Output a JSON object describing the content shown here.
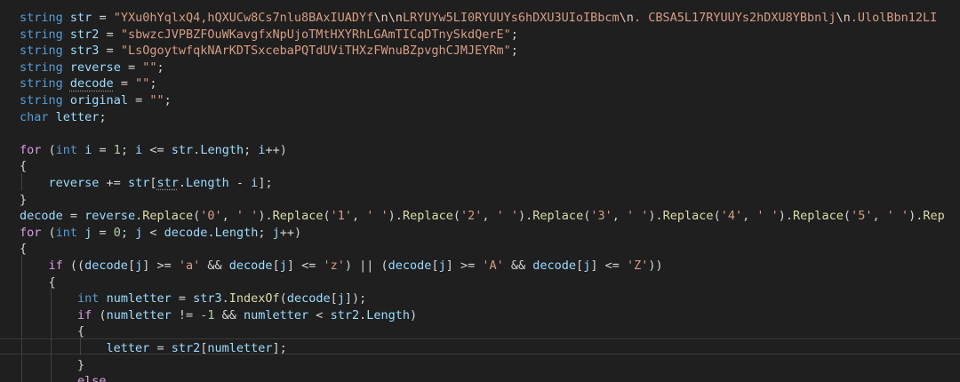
{
  "editor": {
    "language": "csharp",
    "lines": [
      [
        [
          "kw",
          "string"
        ],
        [
          "pl",
          " "
        ],
        [
          "var",
          "str"
        ],
        [
          "pl",
          " = "
        ],
        [
          "str",
          "\"YXu0hYqlxQ4,hQXUCw8Cs7nlu8BAxIUADYf"
        ],
        [
          "esc",
          "\\n\\n"
        ],
        [
          "str",
          "LRYUYw5LI0RYUUYs6hDXU3UIoIBbcm"
        ],
        [
          "esc",
          "\\n"
        ],
        [
          "str",
          ". CBSA5L17RYUUYs2hDXU8YBbnlj"
        ],
        [
          "esc",
          "\\n"
        ],
        [
          "str",
          ".UlolBbn12LI"
        ]
      ],
      [
        [
          "kw",
          "string"
        ],
        [
          "pl",
          " "
        ],
        [
          "var",
          "str2"
        ],
        [
          "pl",
          " = "
        ],
        [
          "str",
          "\"sbwzcJVPBZFOuWKavgfxNpUjoTMtHXYRhLGAmTICqDTnySkdQerE\""
        ],
        [
          "pl",
          ";"
        ]
      ],
      [
        [
          "kw",
          "string"
        ],
        [
          "pl",
          " "
        ],
        [
          "var",
          "str3"
        ],
        [
          "pl",
          " = "
        ],
        [
          "str",
          "\"LsOgoytwfqkNArKDTSxcebaPQTdUViTHXzFWnuBZpvghCJMJEYRm\""
        ],
        [
          "pl",
          ";"
        ]
      ],
      [
        [
          "kw",
          "string"
        ],
        [
          "pl",
          " "
        ],
        [
          "var",
          "reverse"
        ],
        [
          "pl",
          " = "
        ],
        [
          "str",
          "\"\""
        ],
        [
          "pl",
          ";"
        ]
      ],
      [
        [
          "kw",
          "string"
        ],
        [
          "pl",
          " "
        ],
        [
          "var squiggle",
          "decode"
        ],
        [
          "pl",
          " = "
        ],
        [
          "str",
          "\"\""
        ],
        [
          "pl",
          ";"
        ]
      ],
      [
        [
          "kw",
          "string"
        ],
        [
          "pl",
          " "
        ],
        [
          "var",
          "original"
        ],
        [
          "pl",
          " = "
        ],
        [
          "str",
          "\"\""
        ],
        [
          "pl",
          ";"
        ]
      ],
      [
        [
          "kw",
          "char"
        ],
        [
          "pl",
          " "
        ],
        [
          "var",
          "letter"
        ],
        [
          "pl",
          ";"
        ]
      ],
      [],
      [
        [
          "ctl",
          "for"
        ],
        [
          "pl",
          " ("
        ],
        [
          "kw",
          "int"
        ],
        [
          "pl",
          " "
        ],
        [
          "var",
          "i"
        ],
        [
          "pl",
          " = "
        ],
        [
          "num",
          "1"
        ],
        [
          "pl",
          "; "
        ],
        [
          "var",
          "i"
        ],
        [
          "pl",
          " <= "
        ],
        [
          "var",
          "str"
        ],
        [
          "pl",
          "."
        ],
        [
          "var",
          "Length"
        ],
        [
          "pl",
          "; "
        ],
        [
          "var",
          "i"
        ],
        [
          "pl",
          "++)"
        ]
      ],
      [
        [
          "brk",
          "{"
        ]
      ],
      [
        [
          "pl",
          "    "
        ],
        [
          "var",
          "reverse"
        ],
        [
          "pl",
          " += "
        ],
        [
          "var",
          "str"
        ],
        [
          "pl",
          "["
        ],
        [
          "var squiggle",
          "str"
        ],
        [
          "pl",
          "."
        ],
        [
          "var",
          "Length"
        ],
        [
          "pl",
          " - "
        ],
        [
          "var",
          "i"
        ],
        [
          "pl",
          "];"
        ]
      ],
      [
        [
          "brk",
          "}"
        ]
      ],
      [
        [
          "var",
          "decode"
        ],
        [
          "pl",
          " = "
        ],
        [
          "var",
          "reverse"
        ],
        [
          "pl",
          "."
        ],
        [
          "fn",
          "Replace"
        ],
        [
          "pl",
          "("
        ],
        [
          "str",
          "'0'"
        ],
        [
          "pl",
          ", "
        ],
        [
          "str",
          "' '"
        ],
        [
          "pl",
          ")."
        ],
        [
          "fn",
          "Replace"
        ],
        [
          "pl",
          "("
        ],
        [
          "str",
          "'1'"
        ],
        [
          "pl",
          ", "
        ],
        [
          "str",
          "' '"
        ],
        [
          "pl",
          ")."
        ],
        [
          "fn",
          "Replace"
        ],
        [
          "pl",
          "("
        ],
        [
          "str",
          "'2'"
        ],
        [
          "pl",
          ", "
        ],
        [
          "str",
          "' '"
        ],
        [
          "pl",
          ")."
        ],
        [
          "fn",
          "Replace"
        ],
        [
          "pl",
          "("
        ],
        [
          "str",
          "'3'"
        ],
        [
          "pl",
          ", "
        ],
        [
          "str",
          "' '"
        ],
        [
          "pl",
          ")."
        ],
        [
          "fn",
          "Replace"
        ],
        [
          "pl",
          "("
        ],
        [
          "str",
          "'4'"
        ],
        [
          "pl",
          ", "
        ],
        [
          "str",
          "' '"
        ],
        [
          "pl",
          ")."
        ],
        [
          "fn",
          "Replace"
        ],
        [
          "pl",
          "("
        ],
        [
          "str",
          "'5'"
        ],
        [
          "pl",
          ", "
        ],
        [
          "str",
          "' '"
        ],
        [
          "pl",
          ")."
        ],
        [
          "fn",
          "Rep"
        ]
      ],
      [
        [
          "ctl",
          "for"
        ],
        [
          "pl",
          " ("
        ],
        [
          "kw",
          "int"
        ],
        [
          "pl",
          " "
        ],
        [
          "var",
          "j"
        ],
        [
          "pl",
          " = "
        ],
        [
          "num",
          "0"
        ],
        [
          "pl",
          "; "
        ],
        [
          "var",
          "j"
        ],
        [
          "pl",
          " < "
        ],
        [
          "var",
          "decode"
        ],
        [
          "pl",
          "."
        ],
        [
          "var",
          "Length"
        ],
        [
          "pl",
          "; "
        ],
        [
          "var",
          "j"
        ],
        [
          "pl",
          "++)"
        ]
      ],
      [
        [
          "brk",
          "{"
        ]
      ],
      [
        [
          "pl",
          "    "
        ],
        [
          "ctl",
          "if"
        ],
        [
          "pl",
          " (("
        ],
        [
          "var",
          "decode"
        ],
        [
          "pl",
          "["
        ],
        [
          "var",
          "j"
        ],
        [
          "pl",
          "] >= "
        ],
        [
          "str",
          "'a'"
        ],
        [
          "pl",
          " && "
        ],
        [
          "var",
          "decode"
        ],
        [
          "pl",
          "["
        ],
        [
          "var",
          "j"
        ],
        [
          "pl",
          "] <= "
        ],
        [
          "str",
          "'z'"
        ],
        [
          "pl",
          ") || ("
        ],
        [
          "var",
          "decode"
        ],
        [
          "pl",
          "["
        ],
        [
          "var",
          "j"
        ],
        [
          "pl",
          "] >= "
        ],
        [
          "str",
          "'A'"
        ],
        [
          "pl",
          " && "
        ],
        [
          "var",
          "decode"
        ],
        [
          "pl",
          "["
        ],
        [
          "var",
          "j"
        ],
        [
          "pl",
          "] <= "
        ],
        [
          "str",
          "'Z'"
        ],
        [
          "pl",
          "))"
        ]
      ],
      [
        [
          "pl",
          "    "
        ],
        [
          "brk",
          "{"
        ]
      ],
      [
        [
          "pl",
          "        "
        ],
        [
          "kw",
          "int"
        ],
        [
          "pl",
          " "
        ],
        [
          "var",
          "numletter"
        ],
        [
          "pl",
          " = "
        ],
        [
          "var",
          "str3"
        ],
        [
          "pl",
          "."
        ],
        [
          "fn",
          "IndexOf"
        ],
        [
          "pl",
          "("
        ],
        [
          "var",
          "decode"
        ],
        [
          "pl",
          "["
        ],
        [
          "var",
          "j"
        ],
        [
          "pl",
          "]);"
        ]
      ],
      [
        [
          "pl",
          "        "
        ],
        [
          "ctl",
          "if"
        ],
        [
          "pl",
          " ("
        ],
        [
          "var",
          "numletter"
        ],
        [
          "pl",
          " != "
        ],
        [
          "num",
          "-1"
        ],
        [
          "pl",
          " && "
        ],
        [
          "var",
          "numletter"
        ],
        [
          "pl",
          " < "
        ],
        [
          "var",
          "str2"
        ],
        [
          "pl",
          "."
        ],
        [
          "var",
          "Length"
        ],
        [
          "pl",
          ")"
        ]
      ],
      [
        [
          "pl",
          "        "
        ],
        [
          "brk",
          "{"
        ]
      ],
      [
        [
          "pl",
          "            "
        ],
        [
          "var",
          "letter"
        ],
        [
          "pl",
          " = "
        ],
        [
          "var",
          "str2"
        ],
        [
          "pl",
          "["
        ],
        [
          "var",
          "numletter"
        ],
        [
          "pl",
          "];"
        ]
      ],
      [
        [
          "pl",
          "        "
        ],
        [
          "brk",
          "}"
        ]
      ],
      [
        [
          "pl",
          "        "
        ],
        [
          "ctl",
          "else"
        ]
      ]
    ]
  }
}
